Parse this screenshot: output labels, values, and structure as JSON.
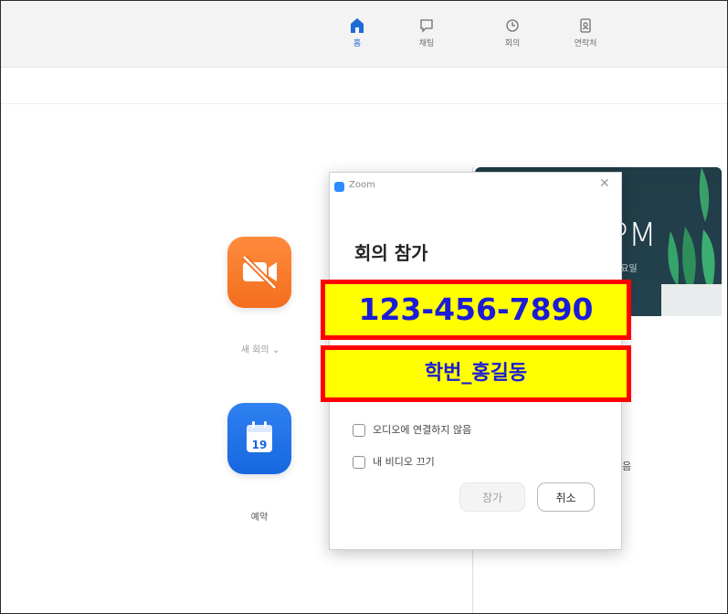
{
  "topnav": {
    "items": [
      {
        "label": "홈",
        "icon": "home-icon",
        "active": true
      },
      {
        "label": "채팅",
        "icon": "chat-icon",
        "active": false
      },
      {
        "label": "회의",
        "icon": "clock-icon",
        "active": false
      },
      {
        "label": "연락처",
        "icon": "contacts-icon",
        "active": false
      }
    ]
  },
  "home": {
    "new_meeting_label": "새 회의 ⌄",
    "schedule_label": "예약",
    "calendar_day": "19"
  },
  "right_panel": {
    "time_text": "PM",
    "day_text": "금요일",
    "no_meetings_text": "없음"
  },
  "dialog": {
    "app_title": "Zoom",
    "heading": "회의 참가",
    "meeting_id_value": "123-456-7890",
    "name_value": "학번_홍길동",
    "options": [
      {
        "label": "오디오에 연결하지 않음",
        "checked": false
      },
      {
        "label": "내 비디오 끄기",
        "checked": false
      }
    ],
    "join_label": "참가",
    "cancel_label": "취소"
  },
  "colors": {
    "accent_blue": "#1f6bd6",
    "new_meeting_orange": "#f36e1e",
    "schedule_blue": "#1767e0",
    "highlight_fill": "#ffff00",
    "highlight_border": "#ff0000",
    "highlight_text": "#1b1bd8",
    "card_bg": "#1f3c47"
  }
}
